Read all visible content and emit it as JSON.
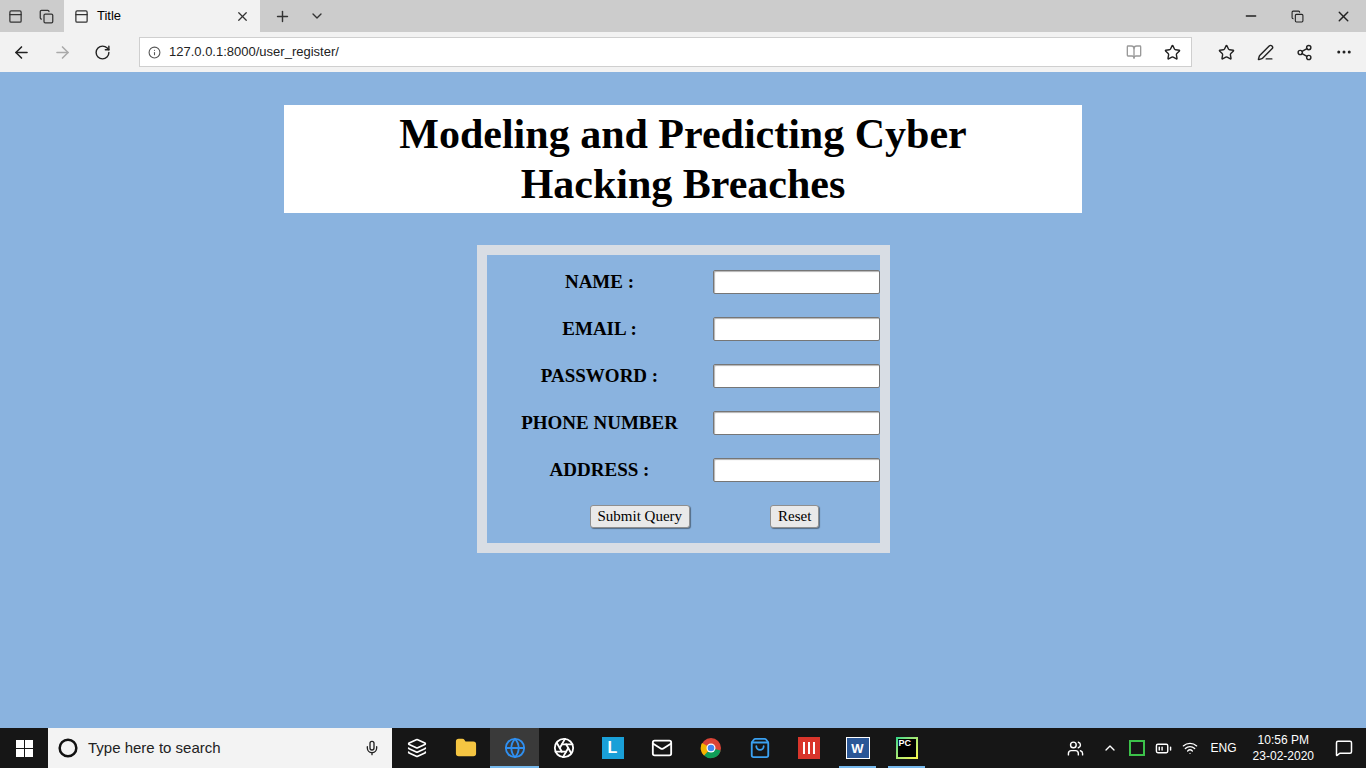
{
  "window": {
    "tab_title": "Title",
    "url": "127.0.0.1:8000/user_register/"
  },
  "page": {
    "title_lines": [
      "Modeling and Predicting Cyber",
      "Hacking Breaches"
    ],
    "form": {
      "fields": [
        {
          "label": "NAME :",
          "value": ""
        },
        {
          "label": "EMAIL :",
          "value": ""
        },
        {
          "label": "PASSWORD :",
          "value": ""
        },
        {
          "label": "PHONE NUMBER",
          "value": ""
        },
        {
          "label": "ADDRESS :",
          "value": ""
        }
      ],
      "buttons": [
        {
          "label": "Submit Query"
        },
        {
          "label": "Reset"
        }
      ]
    }
  },
  "taskbar": {
    "search_placeholder": "Type here to search",
    "apps": [
      {
        "kind": "task-view",
        "glyph": "",
        "running": false,
        "active": false
      },
      {
        "kind": "explorer",
        "glyph": "",
        "running": false,
        "active": false
      },
      {
        "kind": "edge",
        "glyph": "",
        "running": true,
        "active": true
      },
      {
        "kind": "media",
        "glyph": "",
        "running": false,
        "active": false
      },
      {
        "kind": "letter",
        "glyph": "L",
        "running": false,
        "active": false
      },
      {
        "kind": "mail",
        "glyph": "",
        "running": false,
        "active": false
      },
      {
        "kind": "chrome",
        "glyph": "",
        "running": false,
        "active": false
      },
      {
        "kind": "store",
        "glyph": "",
        "running": false,
        "active": false
      },
      {
        "kind": "red-app",
        "glyph": "",
        "running": false,
        "active": false
      },
      {
        "kind": "word",
        "glyph": "W",
        "running": true,
        "active": false
      },
      {
        "kind": "pycharm",
        "glyph": "PC",
        "running": true,
        "active": false
      }
    ],
    "tray": {
      "language": "ENG",
      "time": "10:56 PM",
      "date": "23-02-2020"
    }
  }
}
